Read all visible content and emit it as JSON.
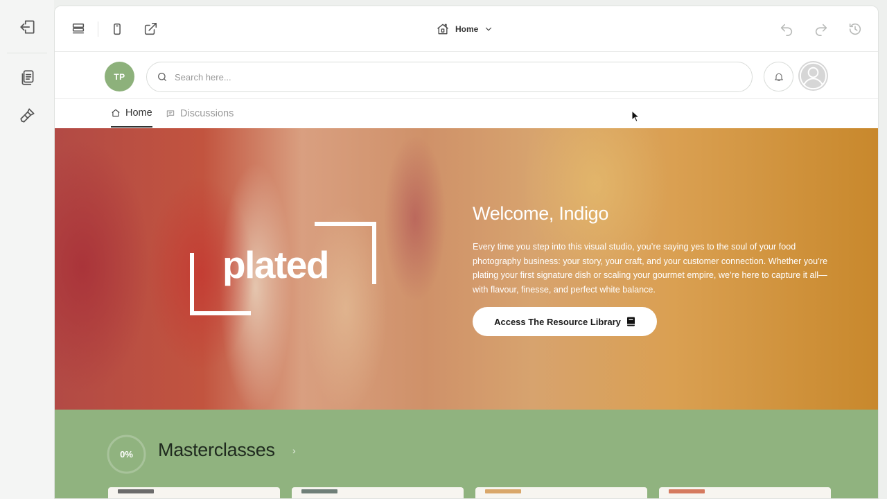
{
  "editor": {
    "page_selector": {
      "label": "Home"
    }
  },
  "portal": {
    "avatar_initials": "TP",
    "search": {
      "placeholder": "Search here...",
      "value": ""
    },
    "nav_tabs": [
      {
        "label": "Home",
        "icon": "home-icon",
        "active": true
      },
      {
        "label": "Discussions",
        "icon": "chat-icon",
        "active": false
      }
    ]
  },
  "hero": {
    "logo_text": "plated",
    "welcome": "Welcome, Indigo",
    "body": "Every time you step into this visual studio, you’re saying yes to the soul of your food photography business: your story, your craft, and your customer connection. Whether you’re plating your first signature dish or scaling your gourmet empire, we’re here to capture it all—with flavour, finesse, and perfect white balance.",
    "cta_label": "Access The Resource Library"
  },
  "masterclasses": {
    "progress": {
      "label": "0%",
      "value": 0
    },
    "title": "Masterclasses",
    "chevron": "›",
    "cards": [
      {
        "thumb_color": "#6b6b6b"
      },
      {
        "thumb_color": "#6f7f78"
      },
      {
        "thumb_color": "#d9a76a"
      },
      {
        "thumb_color": "#d57a5f"
      }
    ]
  },
  "colors": {
    "accent_green": "#90b37f",
    "avatar_green": "#8db17b"
  }
}
